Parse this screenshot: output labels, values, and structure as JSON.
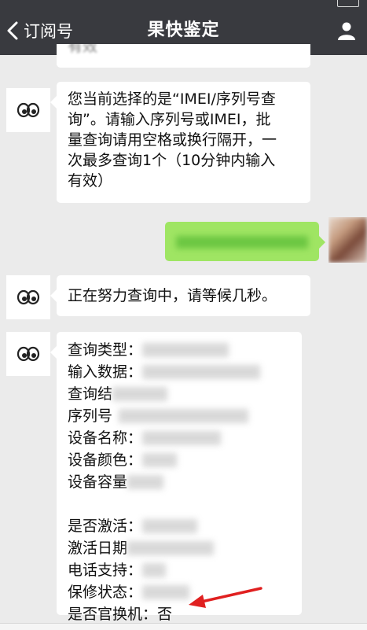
{
  "header": {
    "back_label": "订阅号",
    "title": "果快鉴定"
  },
  "messages": {
    "prev_fragment": "有效",
    "notice": "您当前选择的是“IMEI/序列号查询”。请输入序列号或IMEI，批量查询请用空格或换行隔开，一次最多查询1个（10分钟内输入有效）",
    "notice_lines": [
      "您当前选择的是“IMEI/序列号查",
      "询”。请输入序列号或IMEI，批",
      "量查询请用空格或换行隔开，一",
      "次最多查询1个（10分钟内输入",
      "有效）"
    ],
    "waiting": "正在努力查询中，请等候几秒。"
  },
  "result": {
    "rows": [
      {
        "label": "查询类型："
      },
      {
        "label": "输入数据："
      },
      {
        "label": "查询结"
      },
      {
        "label": "序列号"
      },
      {
        "label": "设备名称："
      },
      {
        "label": "设备颜色："
      },
      {
        "label": "设备容量"
      }
    ],
    "rows2": [
      {
        "label": "是否激活："
      },
      {
        "label": "激活日期"
      },
      {
        "label": "电话支持："
      },
      {
        "label": "保修状态："
      }
    ],
    "official_swap": {
      "label": "是否官换机：",
      "value": "否"
    }
  },
  "colors": {
    "topbar": "#393a3f",
    "sent_bubble": "#9fe563",
    "arrow": "#e02020"
  },
  "icons": {
    "back": "chevron-left-icon",
    "profile": "person-icon",
    "avatar": "eyes-logo-icon"
  }
}
